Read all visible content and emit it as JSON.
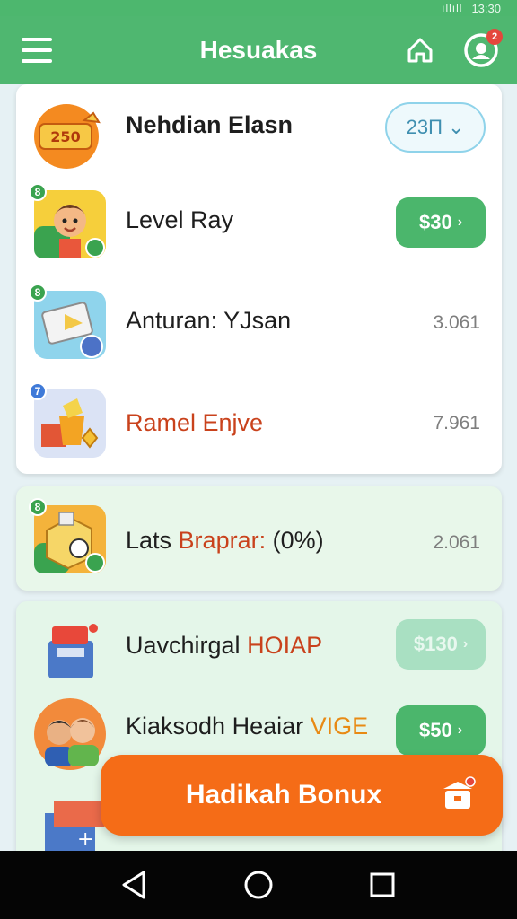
{
  "status_bar": {
    "signal": "ıllıll",
    "time": "13:30"
  },
  "app_bar": {
    "title": "Hesuakas",
    "profile_badge": "2"
  },
  "card1": {
    "rows": [
      {
        "label": "Nehdian Elasn",
        "thumb_text": "250",
        "pill": "23Π",
        "pill_type": "outline"
      },
      {
        "label": "Level Ray",
        "badge": "8",
        "pill": "$30",
        "pill_type": "green"
      },
      {
        "label": "Anturan: YJsan",
        "badge": "8",
        "value": "3.061"
      },
      {
        "label": "Ramel Enjve",
        "badge": "7",
        "value": "7.961"
      }
    ]
  },
  "card2": {
    "row": {
      "label_a": "Lats ",
      "label_b": "Braprar:",
      "label_c": " (0%)",
      "badge": "8",
      "value": "2.061"
    }
  },
  "card3": {
    "rows": [
      {
        "label_a": "Uavchirgal ",
        "label_b": "HOIAP",
        "pill": "$130",
        "pill_type": "faded"
      },
      {
        "label_a": "Kiaksodh Heaiar ",
        "label_b": "VIGE",
        "pill": "$50",
        "pill_type": "green"
      }
    ]
  },
  "bonus_button": {
    "label": "Hadikah Bonux"
  },
  "colors": {
    "brand_green": "#4fb770",
    "accent_orange": "#f56c17",
    "value_gray": "#7e7e7e"
  },
  "icons": {
    "menu": "hamburger-icon",
    "home": "home-icon",
    "profile": "profile-icon",
    "bonus": "gift-icon",
    "back": "back-triangle-icon",
    "home_nav": "home-circle-icon",
    "recents": "recents-square-icon"
  }
}
